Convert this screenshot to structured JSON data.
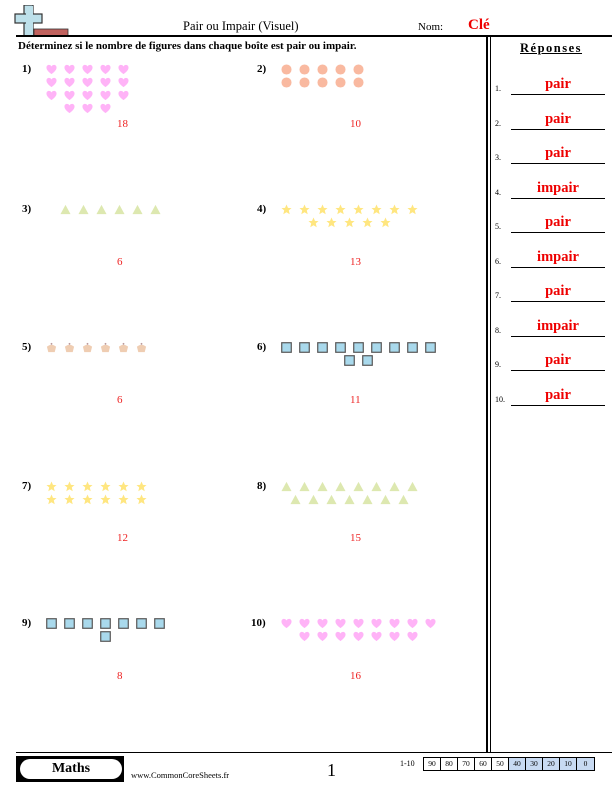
{
  "header": {
    "title": "Pair ou Impair (Visuel)",
    "name_label": "Nom:",
    "name_value": "Clé",
    "instructions": "Déterminez si le nombre de figures dans chaque boîte est pair ou impair."
  },
  "colors": {
    "answer_red": "#e00000",
    "heart": "#ffb3f7",
    "circle": "#f9b9a0",
    "triangle": "#dde8b0",
    "star": "#ffe680",
    "cupcake": "#efcdb2",
    "square": "#a9d9ec"
  },
  "problems": [
    {
      "label": "1)",
      "shape": "heart-icon",
      "rows": [
        5,
        5,
        5,
        3
      ],
      "rows_offset": [
        0,
        0,
        0,
        1
      ],
      "count": "18"
    },
    {
      "label": "2)",
      "shape": "circle-icon",
      "rows": [
        5,
        5
      ],
      "rows_offset": [
        0,
        0
      ],
      "count": "10"
    },
    {
      "label": "3)",
      "shape": "triangle-icon",
      "rows": [
        6
      ],
      "rows_offset": [
        0
      ],
      "count": "6"
    },
    {
      "label": "4)",
      "shape": "star-icon",
      "rows": [
        8,
        5
      ],
      "rows_offset": [
        0,
        1.5
      ],
      "count": "13"
    },
    {
      "label": "5)",
      "shape": "cupcake-icon",
      "rows": [
        6
      ],
      "rows_offset": [
        0
      ],
      "count": "6"
    },
    {
      "label": "6)",
      "shape": "square-icon",
      "rows": [
        9,
        2
      ],
      "rows_offset": [
        0,
        3.5
      ],
      "count": "11"
    },
    {
      "label": "7)",
      "shape": "star-icon",
      "rows": [
        6,
        6
      ],
      "rows_offset": [
        0,
        0
      ],
      "count": "12"
    },
    {
      "label": "8)",
      "shape": "triangle-icon",
      "rows": [
        8,
        7
      ],
      "rows_offset": [
        0,
        0.5
      ],
      "count": "15"
    },
    {
      "label": "9)",
      "shape": "square-icon",
      "rows": [
        7,
        1
      ],
      "rows_offset": [
        0,
        3
      ],
      "count": "8"
    },
    {
      "label": "10)",
      "shape": "heart-icon",
      "rows": [
        9,
        7
      ],
      "rows_offset": [
        0,
        1
      ],
      "count": "16"
    }
  ],
  "answers": {
    "title": "Réponses",
    "items": [
      {
        "num": "1.",
        "value": "pair"
      },
      {
        "num": "2.",
        "value": "pair"
      },
      {
        "num": "3.",
        "value": "pair"
      },
      {
        "num": "4.",
        "value": "impair"
      },
      {
        "num": "5.",
        "value": "pair"
      },
      {
        "num": "6.",
        "value": "impair"
      },
      {
        "num": "7.",
        "value": "pair"
      },
      {
        "num": "8.",
        "value": "impair"
      },
      {
        "num": "9.",
        "value": "pair"
      },
      {
        "num": "10.",
        "value": "pair"
      }
    ]
  },
  "footer": {
    "subject": "Maths",
    "website": "www.CommonCoreSheets.fr",
    "page": "1",
    "score_label": "1-10",
    "scores": [
      "90",
      "80",
      "70",
      "60",
      "50",
      "40",
      "30",
      "20",
      "10",
      "0"
    ],
    "scores_highlighted_from": 5
  }
}
